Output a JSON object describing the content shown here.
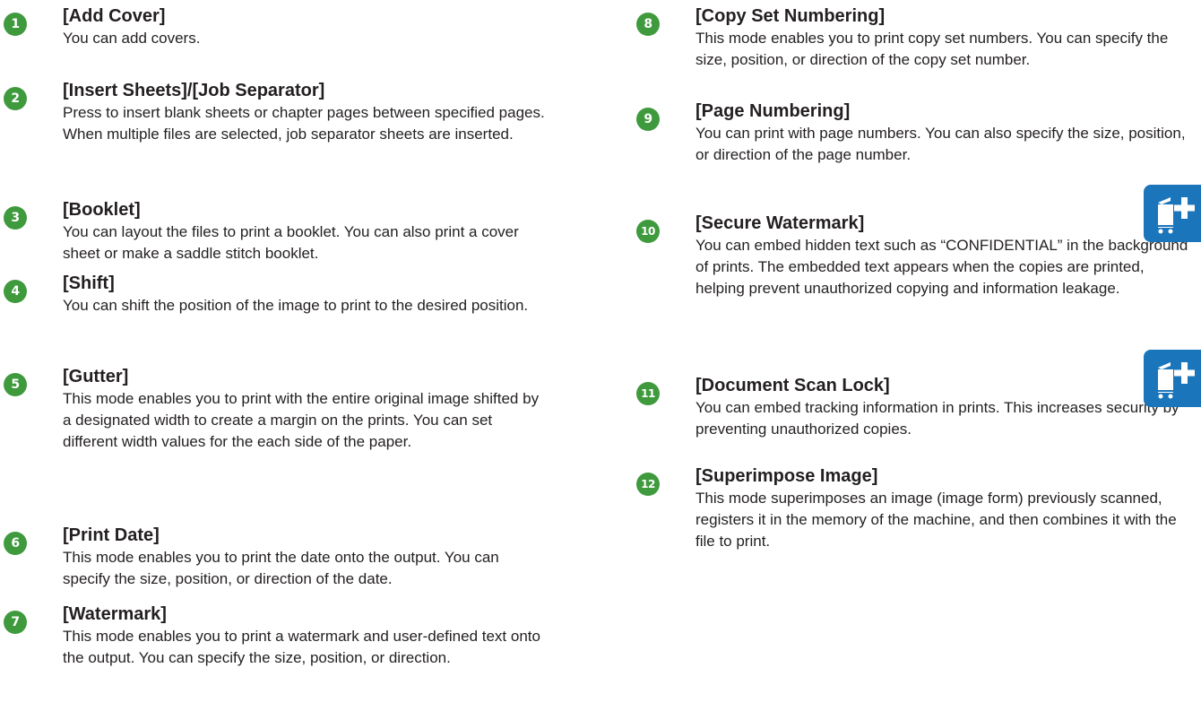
{
  "items": [
    {
      "num": "1",
      "title": "[Add Cover]",
      "desc": "You can add covers."
    },
    {
      "num": "2",
      "title": "[Insert Sheets]/[Job Separator]",
      "desc": "Press to insert blank sheets or chapter pages between specified pages. When multiple files are selected, job separator sheets are inserted."
    },
    {
      "num": "3",
      "title": "[Booklet]",
      "desc": "You can layout the files to print a booklet. You can also print a cover sheet or make a saddle stitch booklet."
    },
    {
      "num": "4",
      "title": "[Shift]",
      "desc": "You can shift the position of the image to print to the desired position."
    },
    {
      "num": "5",
      "title": "[Gutter]",
      "desc": "This mode enables you to print with the entire original image shifted by a designated width to create a margin on the prints. You can set different width values for the each side of the paper."
    },
    {
      "num": "6",
      "title": "[Print Date]",
      "desc": "This mode enables you to print the date onto the output. You can specify the size, position, or direction of the date."
    },
    {
      "num": "7",
      "title": "[Watermark]",
      "desc": "This mode enables you to print a watermark and user-defined text onto the output. You can specify the size, position, or direction."
    },
    {
      "num": "8",
      "title": "[Copy Set Numbering]",
      "desc": "This mode enables you to print copy set numbers. You can specify the size, position, or direction of the copy set number."
    },
    {
      "num": "9",
      "title": "[Page Numbering]",
      "desc": "You can print with page numbers. You can also specify the size, position, or direction of the page number."
    },
    {
      "num": "10",
      "title": "[Secure Watermark]",
      "desc": "You can embed hidden text such as “CONFIDENTIAL” in the background of prints. The embedded text appears when the copies are printed, helping prevent unauthorized copying and information leakage."
    },
    {
      "num": "11",
      "title": "[Document Scan Lock]",
      "desc": "You can embed tracking information in prints. This increases security by preventing unauthorized copies."
    },
    {
      "num": "12",
      "title": "[Superimpose Image]",
      "desc": "This mode superimposes an image (image form) previously scanned, registers it in the memory of the machine, and then combines it with the file to print."
    }
  ],
  "icons": {
    "option_icon": "optional-machine-add-icon",
    "icon_color": "#1a75bb",
    "badge_color": "#3f9a3d"
  }
}
